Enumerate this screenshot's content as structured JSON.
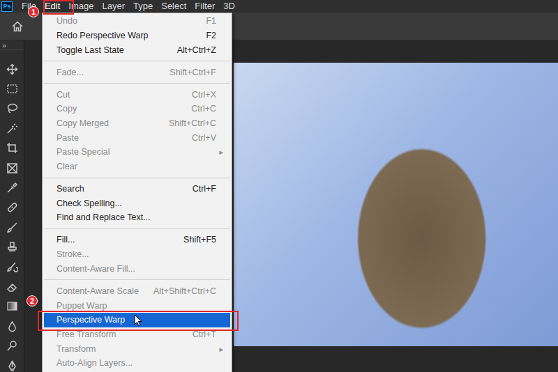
{
  "app": {
    "logo": "Ps"
  },
  "menubar": {
    "items": [
      {
        "label": "File",
        "selected": false
      },
      {
        "label": "Edit",
        "selected": true
      },
      {
        "label": "Image",
        "selected": false
      },
      {
        "label": "Layer",
        "selected": false
      },
      {
        "label": "Type",
        "selected": false
      },
      {
        "label": "Select",
        "selected": false
      },
      {
        "label": "Filter",
        "selected": false
      },
      {
        "label": "3D",
        "selected": false
      }
    ]
  },
  "toolbar": {
    "collapse": "»"
  },
  "menu": {
    "groups": [
      [
        {
          "kind": "command",
          "label": "Undo",
          "shortcut": "F1",
          "disabled": true,
          "selected": false
        },
        {
          "kind": "command",
          "label": "Redo Perspective Warp",
          "shortcut": "F2",
          "disabled": false,
          "selected": false
        },
        {
          "kind": "command",
          "label": "Toggle Last State",
          "shortcut": "Alt+Ctrl+Z",
          "disabled": false,
          "selected": false
        }
      ],
      [
        {
          "kind": "command",
          "label": "Fade...",
          "shortcut": "Shift+Ctrl+F",
          "disabled": true,
          "selected": false
        }
      ],
      [
        {
          "kind": "command",
          "label": "Cut",
          "shortcut": "Ctrl+X",
          "disabled": true,
          "selected": false
        },
        {
          "kind": "command",
          "label": "Copy",
          "shortcut": "Ctrl+C",
          "disabled": true,
          "selected": false
        },
        {
          "kind": "command",
          "label": "Copy Merged",
          "shortcut": "Shift+Ctrl+C",
          "disabled": true,
          "selected": false
        },
        {
          "kind": "command",
          "label": "Paste",
          "shortcut": "Ctrl+V",
          "disabled": true,
          "selected": false
        },
        {
          "kind": "submenu",
          "label": "Paste Special",
          "arrow": "▸",
          "disabled": true,
          "selected": false
        },
        {
          "kind": "command",
          "label": "Clear",
          "disabled": true,
          "selected": false
        }
      ],
      [
        {
          "kind": "command",
          "label": "Search",
          "shortcut": "Ctrl+F",
          "disabled": false,
          "selected": false
        },
        {
          "kind": "command",
          "label": "Check Spelling...",
          "disabled": false,
          "selected": false
        },
        {
          "kind": "command",
          "label": "Find and Replace Text...",
          "disabled": false,
          "selected": false
        }
      ],
      [
        {
          "kind": "command",
          "label": "Fill...",
          "shortcut": "Shift+F5",
          "disabled": false,
          "selected": false
        },
        {
          "kind": "command",
          "label": "Stroke...",
          "disabled": true,
          "selected": false
        },
        {
          "kind": "command",
          "label": "Content-Aware Fill...",
          "disabled": true,
          "selected": false
        }
      ],
      [
        {
          "kind": "command",
          "label": "Content-Aware Scale",
          "shortcut": "Alt+Shift+Ctrl+C",
          "disabled": true,
          "selected": false
        },
        {
          "kind": "command",
          "label": "Puppet Warp",
          "disabled": true,
          "selected": false
        },
        {
          "kind": "command",
          "label": "Perspective Warp",
          "disabled": false,
          "selected": true
        },
        {
          "kind": "command",
          "label": "Free Transform",
          "shortcut": "Ctrl+T",
          "disabled": true,
          "selected": false
        },
        {
          "kind": "submenu",
          "label": "Transform",
          "arrow": "▸",
          "disabled": true,
          "selected": false
        },
        {
          "kind": "command",
          "label": "Auto-Align Layers...",
          "disabled": true,
          "selected": false
        }
      ]
    ]
  },
  "annotations": [
    {
      "label": "1"
    },
    {
      "label": "2"
    }
  ]
}
